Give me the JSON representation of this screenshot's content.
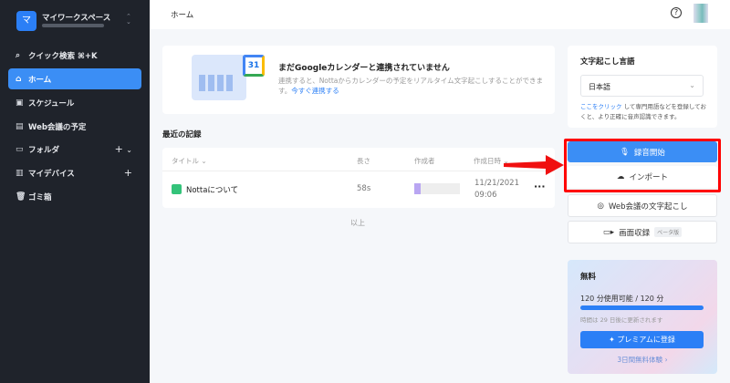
{
  "sidebar": {
    "workspace_initial": "マ",
    "workspace_name": "マイワークスペース",
    "items": [
      {
        "label": "クイック検索 ⌘+K",
        "icon": "search-icon"
      },
      {
        "label": "ホーム",
        "icon": "home-icon"
      },
      {
        "label": "スケジュール",
        "icon": "calendar-check-icon"
      },
      {
        "label": "Web会議の予定",
        "icon": "calendar-icon"
      },
      {
        "label": "フォルダ",
        "icon": "folder-icon"
      },
      {
        "label": "マイデバイス",
        "icon": "device-icon"
      },
      {
        "label": "ゴミ箱",
        "icon": "trash-icon"
      }
    ]
  },
  "header": {
    "title": "ホーム"
  },
  "banner": {
    "calendar_day": "31",
    "title": "まだGoogleカレンダーと連携されていません",
    "desc": "連携すると、Nottaからカレンダーの予定をリアルタイム文字起こしすることができます。",
    "link": "今すぐ連携する"
  },
  "recent": {
    "title": "最近の記録",
    "columns": [
      "タイトル",
      "長さ",
      "作成者",
      "作成日時"
    ],
    "rows": [
      {
        "title": "Nottaについて",
        "length": "58s",
        "date": "11/21/2021",
        "time": "09:06"
      }
    ],
    "end": "以上"
  },
  "lang": {
    "label": "文字起こし言語",
    "value": "日本語",
    "help_link": "ここをクリック",
    "help_text": " して専門用語などを登録しておくと、より正確に音声認識できます。"
  },
  "actions": {
    "record": "録音開始",
    "import": "インポート",
    "web": "Web会議の文字起こし",
    "screen": "画面収録",
    "beta": "ベータ版"
  },
  "plan": {
    "name": "無料",
    "usage": "120 分使用可能 / 120 分",
    "usage_fraction": 1.0,
    "renew": "時間は 29 日後に更新されます",
    "upgrade": "プレミアムに登録",
    "trial": "3日間無料体験"
  },
  "colors": {
    "accent": "#2b7ff6",
    "sidebar": "#1f232b",
    "highlight": "#ff0000"
  }
}
